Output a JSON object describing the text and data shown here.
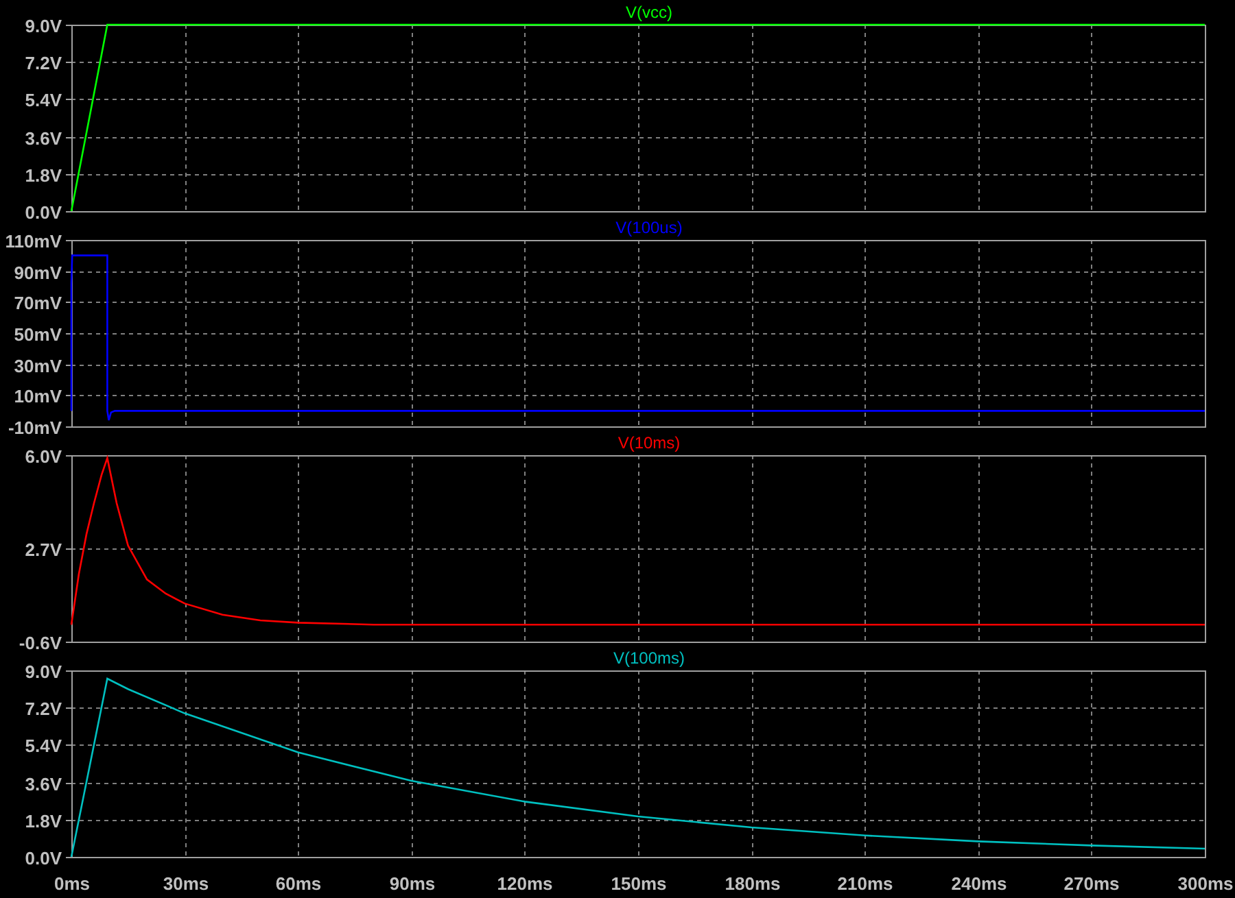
{
  "panes": [
    {
      "chart_data": {
        "type": "line",
        "title": "V(vcc)",
        "grid": true,
        "xlim": [
          0,
          300
        ],
        "ylim": [
          0,
          9
        ],
        "yticks": [
          {
            "value": 0,
            "label": "0.0V"
          },
          {
            "value": 1.8,
            "label": "1.8V"
          },
          {
            "value": 3.6,
            "label": "3.6V"
          },
          {
            "value": 5.4,
            "label": "5.4V"
          },
          {
            "value": 7.2,
            "label": "7.2V"
          },
          {
            "value": 9,
            "label": "9.0V"
          }
        ],
        "x": [
          0,
          9.5,
          300
        ],
        "series": [
          {
            "color": "#00ff00",
            "values": [
              0,
              9,
              9
            ]
          }
        ]
      }
    },
    {
      "chart_data": {
        "type": "line",
        "title": "V(100us)",
        "grid": true,
        "xlim": [
          0,
          300
        ],
        "ylim": [
          -10,
          110
        ],
        "yticks": [
          {
            "value": -10,
            "label": "-10mV"
          },
          {
            "value": 10,
            "label": "10mV"
          },
          {
            "value": 30,
            "label": "30mV"
          },
          {
            "value": 50,
            "label": "50mV"
          },
          {
            "value": 70,
            "label": "70mV"
          },
          {
            "value": 90,
            "label": "90mV"
          },
          {
            "value": 110,
            "label": "110mV"
          }
        ],
        "x": [
          0,
          0,
          0.2,
          9.5,
          9.5,
          9.9,
          10.5,
          11.5,
          300
        ],
        "series": [
          {
            "color": "#0000ff",
            "values": [
              0,
              82,
              100,
              100,
              0,
              -6,
              -1,
              0,
              0
            ]
          }
        ]
      }
    },
    {
      "chart_data": {
        "type": "line",
        "title": "V(10ms)",
        "grid": true,
        "xlim": [
          0,
          300
        ],
        "ylim": [
          -0.6,
          6
        ],
        "yticks": [
          {
            "value": -0.6,
            "label": "-0.6V"
          },
          {
            "value": 2.7,
            "label": "2.7V"
          },
          {
            "value": 6,
            "label": "6.0V"
          }
        ],
        "x": [
          0,
          2,
          4,
          6,
          8,
          9.5,
          12,
          15,
          20,
          25,
          30,
          40,
          50,
          60,
          80,
          300
        ],
        "series": [
          {
            "color": "#ff0000",
            "values": [
              0,
              1.8,
              3.2,
              4.3,
              5.3,
              5.9,
              4.3,
              2.8,
              1.6,
              1.1,
              0.75,
              0.35,
              0.15,
              0.07,
              0,
              0
            ]
          }
        ]
      }
    },
    {
      "chart_data": {
        "type": "line",
        "title": "V(100ms)",
        "grid": true,
        "xlim": [
          0,
          300
        ],
        "ylim": [
          0,
          9
        ],
        "xticks": [
          {
            "value": 0,
            "label": "0ms"
          },
          {
            "value": 30,
            "label": "30ms"
          },
          {
            "value": 60,
            "label": "60ms"
          },
          {
            "value": 90,
            "label": "90ms"
          },
          {
            "value": 120,
            "label": "120ms"
          },
          {
            "value": 150,
            "label": "150ms"
          },
          {
            "value": 180,
            "label": "180ms"
          },
          {
            "value": 210,
            "label": "210ms"
          },
          {
            "value": 240,
            "label": "240ms"
          },
          {
            "value": 270,
            "label": "270ms"
          },
          {
            "value": 300,
            "label": "300ms"
          }
        ],
        "yticks": [
          {
            "value": 0,
            "label": "0.0V"
          },
          {
            "value": 1.8,
            "label": "1.8V"
          },
          {
            "value": 3.6,
            "label": "3.6V"
          },
          {
            "value": 5.4,
            "label": "5.4V"
          },
          {
            "value": 7.2,
            "label": "7.2V"
          },
          {
            "value": 9,
            "label": "9.0V"
          }
        ],
        "x": [
          0,
          9.5,
          15,
          30,
          60,
          90,
          120,
          150,
          180,
          210,
          240,
          270,
          300
        ],
        "series": [
          {
            "color": "#00c0c0",
            "values": [
              0,
              8.6,
              8.1,
              6.93,
              5.04,
              3.67,
              2.67,
              1.95,
              1.42,
              1.03,
              0.75,
              0.55,
              0.4
            ]
          }
        ]
      }
    }
  ]
}
